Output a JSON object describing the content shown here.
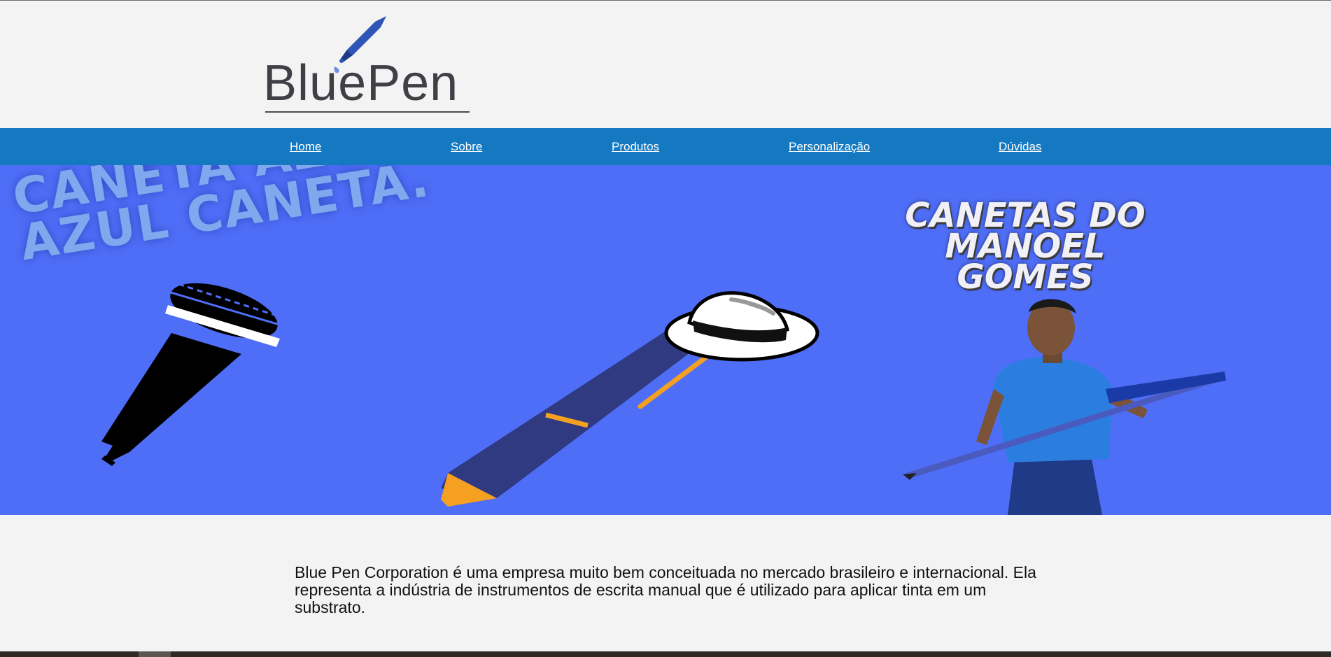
{
  "logo": {
    "text": "BluePen"
  },
  "nav": {
    "items": [
      {
        "label": "Home"
      },
      {
        "label": "Sobre"
      },
      {
        "label": "Produtos"
      },
      {
        "label": "Personalização"
      },
      {
        "label": "Dúvidas"
      }
    ]
  },
  "hero": {
    "slogan": "CANETA AZUL,\nAZUL CANETA.",
    "brand_title": "CANETAS DO\nMANOEL\nGOMES"
  },
  "content": {
    "paragraph": "Blue Pen Corporation é uma empresa muito bem conceituada no mercado brasileiro e internacional. Ela representa a indústria de instrumentos de escrita manual que é utilizado para aplicar tinta em um substrato."
  },
  "colors": {
    "nav_bg": "#1479c0",
    "hero_bg": "#4f6ef8",
    "page_bg": "#f3f3f3"
  }
}
